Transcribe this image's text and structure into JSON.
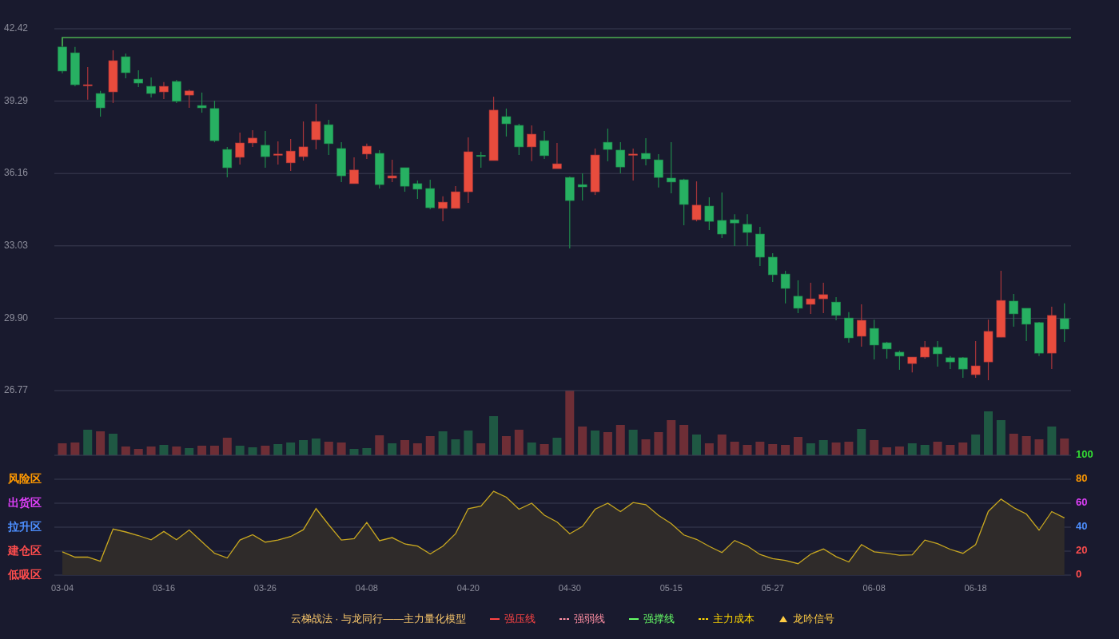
{
  "price_chart": {
    "chart_data": {
      "type": "candlestick",
      "grid": true,
      "categories": [
        null,
        null,
        null,
        null,
        null,
        null,
        null,
        null,
        null,
        null,
        null,
        null,
        null,
        null,
        null,
        null,
        null,
        null,
        null,
        null,
        null,
        null,
        null,
        null,
        null,
        null,
        null,
        null,
        null,
        null,
        null,
        null,
        null,
        null,
        null,
        null,
        null,
        null,
        null,
        null,
        null,
        null,
        null,
        null,
        null,
        null,
        null,
        null,
        null,
        null,
        null,
        null,
        null,
        null,
        null,
        null,
        null,
        null,
        null,
        null,
        null,
        null,
        null,
        null,
        null,
        null,
        null,
        null,
        null,
        null,
        null,
        null,
        null,
        null,
        null,
        null,
        null,
        null,
        null,
        null
      ],
      "ohlc": [
        [
          41.63,
          42.04,
          40.49,
          40.59
        ],
        [
          41.38,
          41.63,
          39.93,
          40.0
        ],
        [
          39.99,
          40.76,
          39.35,
          40.0
        ],
        [
          39.62,
          39.73,
          38.62,
          39.0
        ],
        [
          39.69,
          41.49,
          39.21,
          41.04
        ],
        [
          41.21,
          41.35,
          40.28,
          40.52
        ],
        [
          40.24,
          40.62,
          39.9,
          40.07
        ],
        [
          39.93,
          40.31,
          39.45,
          39.62
        ],
        [
          39.69,
          40.11,
          39.38,
          39.93
        ],
        [
          40.14,
          40.21,
          39.21,
          39.28
        ],
        [
          39.55,
          39.79,
          39.0,
          39.73
        ],
        [
          39.1,
          39.66,
          38.79,
          39.0
        ],
        [
          38.97,
          39.31,
          37.51,
          37.58
        ],
        [
          37.2,
          37.31,
          35.99,
          36.41
        ],
        [
          36.86,
          37.93,
          36.55,
          37.48
        ],
        [
          37.48,
          38.03,
          37.31,
          37.69
        ],
        [
          37.38,
          38.0,
          36.41,
          36.89
        ],
        [
          36.99,
          37.55,
          36.55,
          37.0
        ],
        [
          36.62,
          37.65,
          36.27,
          37.13
        ],
        [
          36.89,
          38.41,
          36.72,
          37.31
        ],
        [
          37.62,
          39.17,
          37.2,
          38.41
        ],
        [
          38.27,
          38.48,
          36.96,
          37.45
        ],
        [
          37.24,
          37.51,
          35.79,
          36.06
        ],
        [
          35.72,
          36.86,
          35.72,
          36.31
        ],
        [
          37.0,
          37.45,
          36.79,
          37.34
        ],
        [
          37.03,
          37.17,
          35.51,
          35.68
        ],
        [
          35.96,
          36.75,
          35.79,
          36.06
        ],
        [
          36.41,
          36.41,
          35.37,
          35.61
        ],
        [
          35.72,
          35.86,
          35.06,
          35.48
        ],
        [
          35.51,
          35.89,
          34.61,
          34.68
        ],
        [
          34.65,
          35.17,
          34.09,
          34.92
        ],
        [
          34.65,
          35.61,
          34.65,
          35.37
        ],
        [
          35.37,
          37.72,
          34.89,
          37.1
        ],
        [
          36.95,
          37.1,
          36.41,
          36.93
        ],
        [
          36.72,
          39.48,
          36.72,
          38.9
        ],
        [
          38.62,
          38.97,
          37.76,
          38.31
        ],
        [
          38.24,
          38.31,
          36.96,
          37.31
        ],
        [
          37.31,
          38.24,
          36.69,
          37.86
        ],
        [
          37.58,
          38.0,
          36.79,
          36.93
        ],
        [
          36.37,
          37.48,
          36.37,
          36.58
        ],
        [
          35.99,
          36.03,
          32.92,
          34.99
        ],
        [
          35.68,
          36.17,
          34.99,
          35.58
        ],
        [
          35.37,
          37.24,
          35.23,
          36.96
        ],
        [
          37.51,
          38.1,
          36.69,
          37.2
        ],
        [
          37.17,
          37.51,
          36.17,
          36.44
        ],
        [
          36.99,
          37.24,
          35.86,
          37.0
        ],
        [
          37.03,
          37.69,
          36.51,
          36.79
        ],
        [
          36.75,
          37.0,
          35.55,
          35.99
        ],
        [
          35.96,
          37.51,
          35.3,
          35.79
        ],
        [
          35.89,
          35.93,
          33.92,
          34.82
        ],
        [
          34.16,
          35.82,
          34.09,
          34.79
        ],
        [
          34.75,
          35.13,
          33.71,
          34.09
        ],
        [
          34.13,
          35.34,
          33.37,
          33.54
        ],
        [
          34.16,
          34.4,
          33.02,
          34.02
        ],
        [
          33.96,
          34.4,
          33.02,
          33.61
        ],
        [
          33.54,
          33.85,
          32.16,
          32.54
        ],
        [
          32.54,
          32.71,
          31.47,
          31.78
        ],
        [
          31.81,
          31.95,
          30.54,
          31.19
        ],
        [
          30.85,
          31.54,
          30.12,
          30.33
        ],
        [
          30.5,
          31.43,
          30.09,
          30.74
        ],
        [
          30.74,
          31.43,
          30.12,
          30.92
        ],
        [
          30.6,
          30.81,
          29.81,
          30.02
        ],
        [
          29.91,
          30.16,
          28.84,
          29.05
        ],
        [
          29.12,
          30.5,
          28.67,
          29.81
        ],
        [
          29.46,
          29.84,
          28.12,
          28.74
        ],
        [
          28.84,
          28.88,
          28.15,
          28.57
        ],
        [
          28.43,
          28.5,
          27.67,
          28.26
        ],
        [
          27.94,
          28.22,
          27.56,
          28.22
        ],
        [
          28.22,
          28.91,
          28.15,
          28.64
        ],
        [
          28.64,
          28.91,
          27.81,
          28.36
        ],
        [
          28.19,
          28.26,
          27.7,
          28.01
        ],
        [
          28.19,
          28.22,
          27.32,
          27.7
        ],
        [
          27.46,
          28.91,
          27.32,
          27.84
        ],
        [
          28.01,
          29.84,
          27.22,
          29.33
        ],
        [
          29.08,
          31.95,
          29.08,
          30.67
        ],
        [
          30.64,
          30.95,
          29.53,
          30.09
        ],
        [
          30.33,
          30.33,
          28.91,
          29.64
        ],
        [
          29.71,
          29.74,
          28.26,
          28.39
        ],
        [
          28.39,
          30.4,
          27.7,
          30.02
        ],
        [
          29.88,
          30.54,
          28.88,
          29.43
        ]
      ],
      "ylim": [
        26.77,
        42.42
      ],
      "yticks": [
        {
          "value": 42.42,
          "label": "42.42"
        },
        {
          "value": 39.29,
          "label": "39.29"
        },
        {
          "value": 36.16,
          "label": "36.16"
        },
        {
          "value": 33.03,
          "label": "33.03"
        },
        {
          "value": 29.9,
          "label": "29.90"
        },
        {
          "value": 26.77,
          "label": "26.77"
        }
      ]
    }
  },
  "indicator_chart": {
    "zones": [
      {
        "label": "风险区",
        "color": "#ff9900"
      },
      {
        "label": "出货区",
        "color": "#e040fb"
      },
      {
        "label": "拉升区",
        "color": "#4d8fff"
      },
      {
        "label": "建仓区",
        "color": "#ff4d4d"
      },
      {
        "label": "低吸区",
        "color": "#ff4d4d"
      }
    ],
    "tick_colors": [
      {
        "color": "#33dd33"
      },
      {
        "color": "#ff9900"
      },
      {
        "color": "#e040fb"
      },
      {
        "color": "#4d8fff"
      },
      {
        "color": "#ff4d4d"
      },
      {
        "color": "#ff4d4d"
      }
    ],
    "chart_data": {
      "type": "area",
      "grid": true,
      "categories": [
        "03-04",
        null,
        null,
        null,
        null,
        null,
        null,
        null,
        "03-16",
        null,
        null,
        null,
        null,
        null,
        null,
        null,
        "03-26",
        null,
        null,
        null,
        null,
        null,
        null,
        null,
        "04-08",
        null,
        null,
        null,
        null,
        null,
        null,
        null,
        "04-20",
        null,
        null,
        null,
        null,
        null,
        null,
        null,
        "04-30",
        null,
        null,
        null,
        null,
        null,
        null,
        null,
        "05-15",
        null,
        null,
        null,
        null,
        null,
        null,
        null,
        "05-27",
        null,
        null,
        null,
        null,
        null,
        null,
        null,
        "06-08",
        null,
        null,
        null,
        null,
        null,
        null,
        null,
        "06-18",
        null,
        null,
        null,
        null,
        null,
        null,
        null
      ],
      "series": [
        {
          "color": "#c9a820",
          "values": [
            19.4,
            15,
            15,
            11.6,
            38.5,
            36,
            33,
            29.5,
            36.4,
            29.5,
            37.6,
            27.8,
            18.2,
            14.3,
            29.3,
            33.7,
            27.5,
            29.3,
            32.2,
            37.9,
            55.5,
            42,
            29.3,
            30.4,
            43.9,
            28.7,
            31.3,
            26,
            24.2,
            17.6,
            24.2,
            34.6,
            55.5,
            57.6,
            69.9,
            65,
            55,
            60,
            50,
            44.3,
            34.5,
            40.6,
            55,
            60,
            53,
            60.6,
            58.8,
            49.8,
            43,
            33.5,
            29.8,
            24,
            18.8,
            28.9,
            24.3,
            17.2,
            13.8,
            12.3,
            9.5,
            17.5,
            21.8,
            15.4,
            11,
            25.5,
            19.4,
            18.2,
            16.6,
            16.9,
            29.2,
            26.2,
            21.5,
            18.2,
            25.5,
            53.2,
            63.4,
            56.3,
            51,
            37.5,
            53,
            47.7
          ]
        }
      ],
      "ylim": [
        0,
        100
      ],
      "yticks": [
        100,
        80,
        60,
        40,
        20,
        0
      ]
    }
  },
  "legend": {
    "title": "云梯战法 · 与龙同行——主力量化模型",
    "items": [
      {
        "kind": "solid",
        "label": "强压线",
        "color": "#ff4444"
      },
      {
        "kind": "dashed",
        "label": "强弱线",
        "color": "#ff8fa3"
      },
      {
        "kind": "solid",
        "label": "强撑线",
        "color": "#66ff66"
      },
      {
        "kind": "dashed",
        "label": "主力成本",
        "color": "#ffd700"
      },
      {
        "kind": "triangle",
        "label": "龙吟信号",
        "color": "#ffcc44"
      }
    ]
  }
}
